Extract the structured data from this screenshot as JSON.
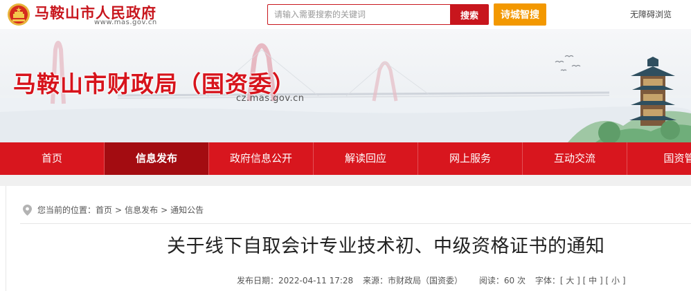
{
  "header": {
    "site_name": "马鞍山市人民政府",
    "site_url": "www.mas.gov.cn",
    "search_placeholder": "请输入需要搜索的关键词",
    "search_label": "搜索",
    "poem_search_label": "诗城智搜",
    "accessibility_label": "无障碍浏览"
  },
  "banner": {
    "department_title": "马鞍山市财政局（国资委）",
    "department_url": "cz.mas.gov.cn"
  },
  "nav": {
    "items": [
      "首页",
      "信息发布",
      "政府信息公开",
      "解读回应",
      "网上服务",
      "互动交流",
      "国资管"
    ],
    "active_index": 1
  },
  "breadcrumb": {
    "prefix": "您当前的位置：",
    "items": [
      "首页",
      "信息发布",
      "通知公告"
    ],
    "separator": ">"
  },
  "article": {
    "title": "关于线下自取会计专业技术初、中级资格证书的通知",
    "date_label": "发布日期：",
    "date": "2022-04-11 17:28",
    "source_label": "来源：",
    "source": "市财政局（国资委）",
    "views_label": "阅读：",
    "views": "60",
    "views_unit": "次",
    "font_label": "字体：",
    "font_sizes": [
      "大",
      "中",
      "小"
    ]
  },
  "colors": {
    "brand_red": "#d8161e",
    "nav_active": "#a30c11",
    "poem_orange": "#f39800"
  }
}
